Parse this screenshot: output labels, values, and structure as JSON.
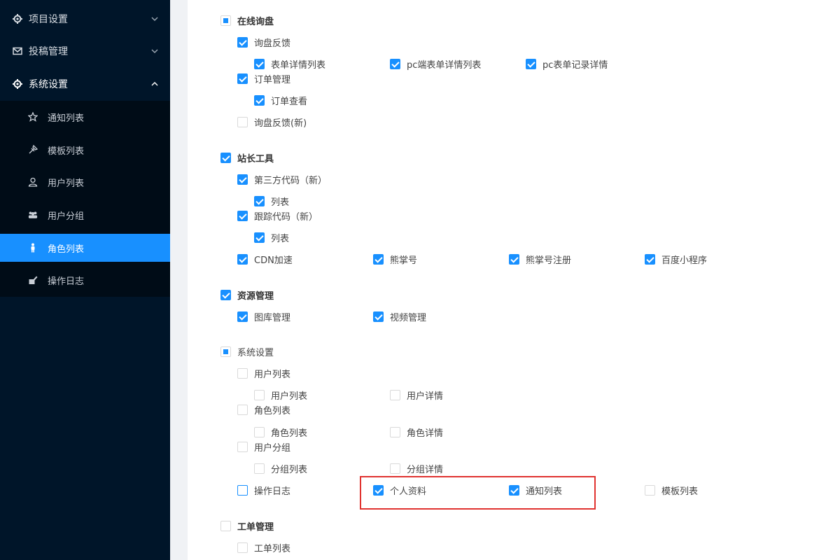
{
  "sidebar": {
    "menu": [
      {
        "label": "项目设置",
        "icon": "gear-icon"
      },
      {
        "label": "投稿管理",
        "icon": "mail-icon"
      },
      {
        "label": "系统设置",
        "icon": "gear-icon"
      }
    ],
    "submenu": [
      {
        "label": "通知列表",
        "icon": "star-icon"
      },
      {
        "label": "模板列表",
        "icon": "pin-icon"
      },
      {
        "label": "用户列表",
        "icon": "user-icon"
      },
      {
        "label": "用户分组",
        "icon": "group-icon"
      },
      {
        "label": "角色列表",
        "icon": "person-icon",
        "active": true
      },
      {
        "label": "操作日志",
        "icon": "edit-icon"
      }
    ]
  },
  "permissions": {
    "inquiry": {
      "label": "在线询盘",
      "state": "indeterminate",
      "feedback": {
        "label": "询盘反馈",
        "state": "checked"
      },
      "form_detail_list": {
        "label": "表单详情列表",
        "state": "checked"
      },
      "pc_form_detail_list": {
        "label": "pc端表单详情列表",
        "state": "checked"
      },
      "pc_form_record": {
        "label": "pc表单记录详情",
        "state": "checked"
      },
      "order_mgmt": {
        "label": "订单管理",
        "state": "checked"
      },
      "order_view": {
        "label": "订单查看",
        "state": "checked"
      },
      "feedback_new": {
        "label": "询盘反馈(新)",
        "state": "unchecked"
      }
    },
    "webmaster": {
      "label": "站长工具",
      "state": "checked",
      "third_party_code": {
        "label": "第三方代码（新）",
        "state": "checked"
      },
      "third_party_list": {
        "label": "列表",
        "state": "checked"
      },
      "tracking_code": {
        "label": "跟踪代码（新）",
        "state": "checked"
      },
      "tracking_list": {
        "label": "列表",
        "state": "checked"
      },
      "cdn": {
        "label": "CDN加速",
        "state": "checked"
      },
      "xiongzhang": {
        "label": "熊掌号",
        "state": "checked"
      },
      "xiongzhang_reg": {
        "label": "熊掌号注册",
        "state": "checked"
      },
      "baidu_mini": {
        "label": "百度小程序",
        "state": "checked"
      }
    },
    "resources": {
      "label": "资源管理",
      "state": "checked",
      "gallery": {
        "label": "图库管理",
        "state": "checked"
      },
      "video": {
        "label": "视频管理",
        "state": "checked"
      }
    },
    "system": {
      "label": "系统设置",
      "state": "indeterminate",
      "user_list": {
        "label": "用户列表",
        "state": "unchecked"
      },
      "user_list_sub": {
        "label": "用户列表",
        "state": "unchecked"
      },
      "user_detail": {
        "label": "用户详情",
        "state": "unchecked"
      },
      "role_list": {
        "label": "角色列表",
        "state": "unchecked"
      },
      "role_list_sub": {
        "label": "角色列表",
        "state": "unchecked"
      },
      "role_detail": {
        "label": "角色详情",
        "state": "unchecked"
      },
      "user_group": {
        "label": "用户分组",
        "state": "unchecked"
      },
      "group_list": {
        "label": "分组列表",
        "state": "unchecked"
      },
      "group_detail": {
        "label": "分组详情",
        "state": "unchecked"
      },
      "op_log": {
        "label": "操作日志",
        "state": "unchecked"
      },
      "profile": {
        "label": "个人资料",
        "state": "checked"
      },
      "notice_list": {
        "label": "通知列表",
        "state": "checked"
      },
      "template_list": {
        "label": "模板列表",
        "state": "unchecked"
      }
    },
    "ticket": {
      "label": "工单管理",
      "state": "unchecked",
      "ticket_list": {
        "label": "工单列表",
        "state": "unchecked"
      }
    }
  },
  "colors": {
    "sidebar": "#001529",
    "submenu": "#000c17",
    "accent": "#1890ff",
    "highlight": "#e0322f"
  }
}
